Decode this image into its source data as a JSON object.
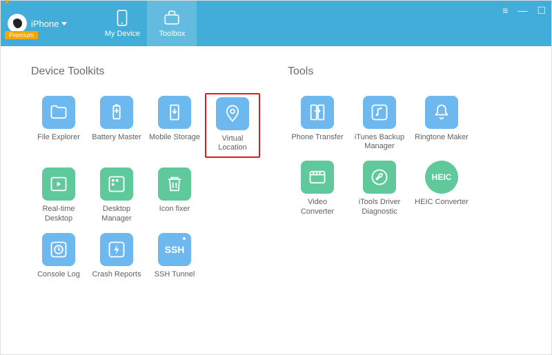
{
  "header": {
    "device_label": "iPhone",
    "premium_badge": "Premium",
    "tabs": {
      "my_device": "My Device",
      "toolbox": "Toolbox"
    }
  },
  "sections": {
    "device_toolkits": "Device Toolkits",
    "tools": "Tools"
  },
  "device_toolkits": {
    "file_explorer": "File Explorer",
    "battery_master": "Battery Master",
    "mobile_storage": "Mobile Storage",
    "virtual_location": "Virtual Location",
    "realtime_desktop": "Real-time Desktop",
    "desktop_manager": "Desktop Manager",
    "icon_fixer": "Icon fixer",
    "console_log": "Console Log",
    "crash_reports": "Crash Reports",
    "ssh_tunnel": "SSH Tunnel"
  },
  "tools": {
    "phone_transfer": "Phone Transfer",
    "itunes_backup_manager": "iTunes Backup Manager",
    "ringtone_maker": "Ringtone Maker",
    "video_converter": "Video Converter",
    "itools_driver_diagnostic": "iTools Driver Diagnostic",
    "heic_converter": "HEIC Converter"
  },
  "icon_text": {
    "ssh": "SSH",
    "heic": "HEIC"
  },
  "colors": {
    "primary": "#41add8",
    "tile_blue": "#6cb8ef",
    "tile_green": "#5fc99c",
    "highlight": "#e11919"
  }
}
